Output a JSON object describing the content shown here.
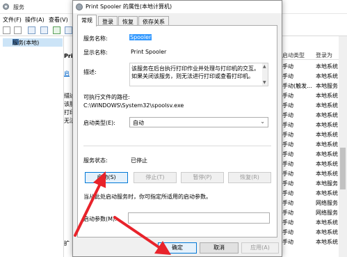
{
  "background": {
    "title": "服务",
    "menu": [
      "文件(F)",
      "操作(A)",
      "查看(V)"
    ],
    "tree_item": "服务(本地)",
    "middle_fragments": [
      "Pri",
      "启",
      "描述",
      "该服",
      "打印",
      "无法",
      "扩"
    ],
    "columns": {
      "startup_type": "启动类型",
      "log_on_as": "登录为"
    },
    "rows": [
      {
        "startup": "手动",
        "logon": "本地系统"
      },
      {
        "startup": "手动",
        "logon": "本地系统"
      },
      {
        "startup": "手动(触发...",
        "logon": "本地服务"
      },
      {
        "startup": "手动",
        "logon": "本地系统"
      },
      {
        "startup": "手动",
        "logon": "本地系统"
      },
      {
        "startup": "手动",
        "logon": "本地系统"
      },
      {
        "startup": "手动",
        "logon": "本地系统"
      },
      {
        "startup": "手动",
        "logon": "本地系统"
      },
      {
        "startup": "手动",
        "logon": "本地系统"
      },
      {
        "startup": "手动",
        "logon": "本地系统"
      },
      {
        "startup": "手动",
        "logon": "本地系统"
      },
      {
        "startup": "手动",
        "logon": "本地系统"
      },
      {
        "startup": "手动",
        "logon": "本地服务"
      },
      {
        "startup": "手动",
        "logon": "本地系统"
      },
      {
        "startup": "手动",
        "logon": "网络服务"
      },
      {
        "startup": "手动",
        "logon": "网络服务"
      },
      {
        "startup": "手动",
        "logon": "本地系统"
      },
      {
        "startup": "手动",
        "logon": "本地系统"
      },
      {
        "startup": "手动",
        "logon": "本地系统"
      }
    ]
  },
  "dialog": {
    "title": "Print Spooler 的属性(本地计算机)",
    "tabs": [
      "常规",
      "登录",
      "恢复",
      "依存关系"
    ],
    "service_name_label": "服务名称:",
    "service_name": "Spooler",
    "display_name_label": "显示名称:",
    "display_name": "Print Spooler",
    "description_label": "描述:",
    "description": "该服务在后台执行打印作业并处理与打印机的交互。如果关闭该服务，则无法进行打印或查看打印机。",
    "exe_path_label": "可执行文件的路径:",
    "exe_path": "C:\\WINDOWS\\System32\\spoolsv.exe",
    "startup_type_label": "启动类型(E):",
    "startup_type": "自动",
    "service_status_label": "服务状态:",
    "service_status": "已停止",
    "buttons": {
      "start": "启动(S)",
      "stop": "停止(T)",
      "pause": "暂停(P)",
      "resume": "恢复(R)"
    },
    "hint": "当从此处启动服务时，你可指定所适用的启动参数。",
    "start_params_label": "启动参数(M):",
    "start_params_value": "",
    "footer": {
      "ok": "确定",
      "cancel": "取消",
      "apply": "应用(A)"
    }
  },
  "colors": {
    "annotation_arrow": "#e8232b",
    "selection": "#3399ff"
  }
}
